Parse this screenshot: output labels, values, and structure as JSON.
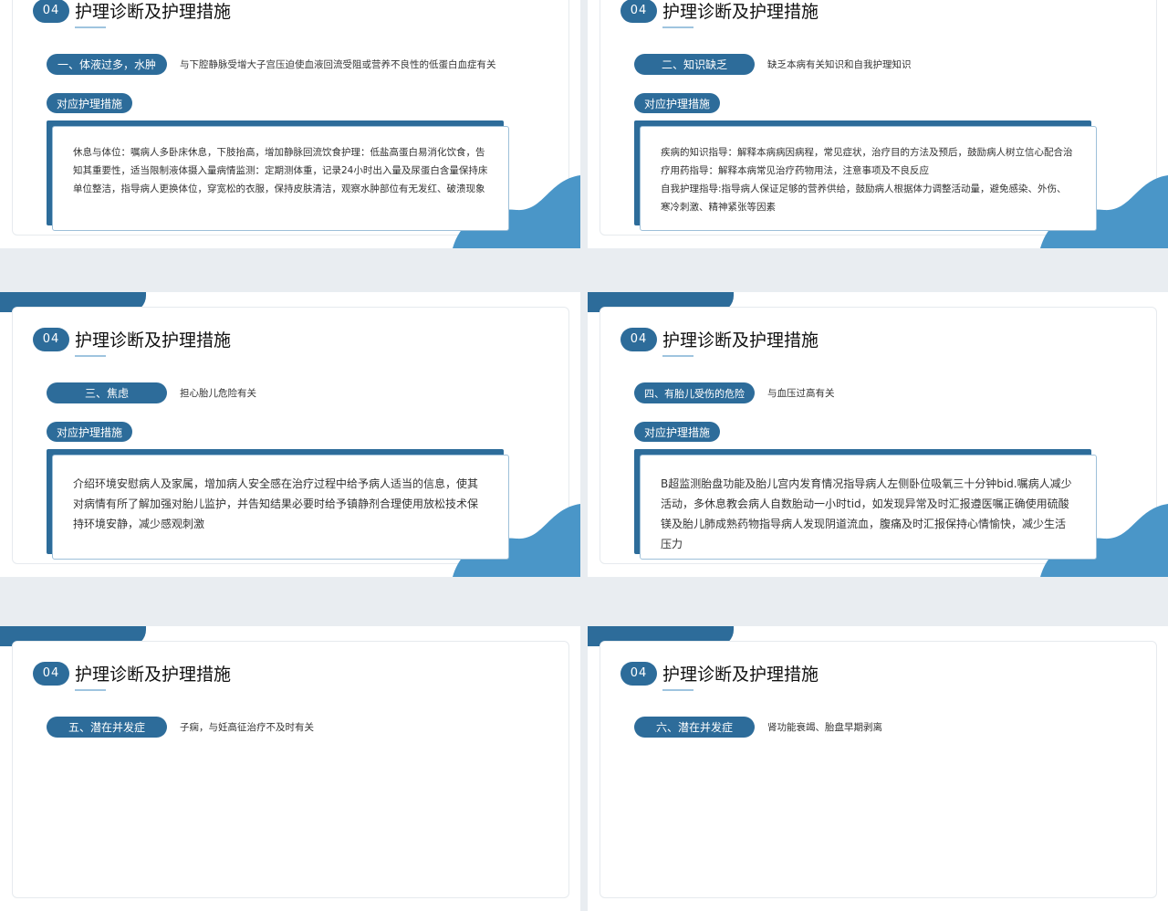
{
  "slides": [
    {
      "num": "04",
      "title": "护理诊断及护理措施",
      "diagnosis": "一、体液过多，水肿",
      "cause": "与下腔静脉受增大子宫压迫使血液回流受阻或营养不良性的低蛋白血症有关",
      "measure_label": "对应护理措施",
      "measure_text": "休息与体位：嘱病人多卧床休息，下肢抬高，增加静脉回流饮食护理：低盐高蛋白易消化饮食，告知其重要性，适当限制液体摄入量病情监测：定期测体重，记录24小时出入量及尿蛋白含量保持床单位整洁，指导病人更换体位，穿宽松的衣服，保持皮肤清洁，观察水肿部位有无发红、破溃现象"
    },
    {
      "num": "04",
      "title": "护理诊断及护理措施",
      "diagnosis": "二、知识缺乏",
      "cause": "缺乏本病有关知识和自我护理知识",
      "measure_label": "对应护理措施",
      "measure_text": "疾病的知识指导：解释本病病因病程，常见症状，治疗目的方法及预后，鼓励病人树立信心配合治疗用药指导：解释本病常见治疗药物用法，注意事项及不良反应\n自我护理指导:指导病人保证足够的营养供给，鼓励病人根据体力调整活动量，避免感染、外伤、寒冷刺激、精神紧张等因素"
    },
    {
      "num": "04",
      "title": "护理诊断及护理措施",
      "diagnosis": "三、焦虑",
      "cause": "担心胎儿危险有关",
      "measure_label": "对应护理措施",
      "measure_text": "介绍环境安慰病人及家属，增加病人安全感在治疗过程中给予病人适当的信息，使其对病情有所了解加强对胎儿监护，并告知结果必要时给予镇静剂合理使用放松技术保持环境安静，减少感观刺激"
    },
    {
      "num": "04",
      "title": "护理诊断及护理措施",
      "diagnosis": "四、有胎儿受伤的危险",
      "cause": "与血压过高有关",
      "measure_label": "对应护理措施",
      "measure_text": "B超监测胎盘功能及胎儿宫内发育情况指导病人左侧卧位吸氧三十分钟bid.嘱病人减少活动，多休息教会病人自数胎动一小时tid，如发现异常及时汇报遵医嘱正确使用硫酸镁及胎儿肺成熟药物指导病人发现阴道流血，腹痛及时汇报保持心情愉快，减少生活压力"
    },
    {
      "num": "04",
      "title": "护理诊断及护理措施",
      "diagnosis": "五、潜在并发症",
      "cause": "子痫，与妊高征治疗不及时有关"
    },
    {
      "num": "04",
      "title": "护理诊断及护理措施",
      "diagnosis": "六、潜在并发症",
      "cause": "肾功能衰竭、胎盘早期剥离"
    }
  ]
}
